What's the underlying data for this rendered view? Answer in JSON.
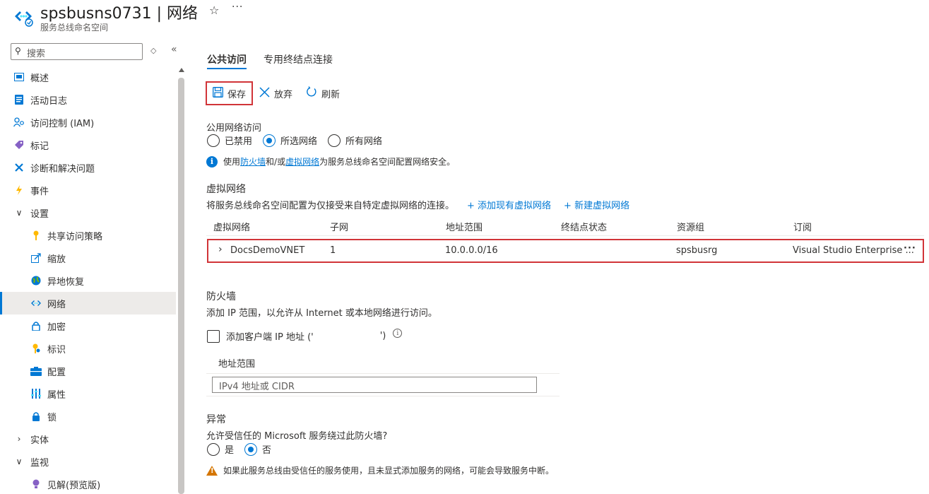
{
  "header": {
    "title": "spsbusns0731 | 网络",
    "subtitle": "服务总线命名空间",
    "star_icon": "☆",
    "more_icon": "···"
  },
  "sidebar": {
    "search_placeholder": "搜索",
    "items": [
      {
        "label": "概述",
        "icon": "overview-icon",
        "level": 0
      },
      {
        "label": "活动日志",
        "icon": "activity-log-icon",
        "level": 0
      },
      {
        "label": "访问控制 (IAM)",
        "icon": "iam-icon",
        "level": 0
      },
      {
        "label": "标记",
        "icon": "tag-icon",
        "level": 0
      },
      {
        "label": "诊断和解决问题",
        "icon": "wrench-icon",
        "level": 0
      },
      {
        "label": "事件",
        "icon": "bolt-icon",
        "level": 0
      },
      {
        "label": "设置",
        "icon": "chevron-down-icon",
        "level": 0,
        "group": true,
        "expanded": true
      },
      {
        "label": "共享访问策略",
        "icon": "key-icon",
        "level": 1
      },
      {
        "label": "缩放",
        "icon": "scale-icon",
        "level": 1
      },
      {
        "label": "异地恢复",
        "icon": "globe-icon",
        "level": 1
      },
      {
        "label": "网络",
        "icon": "network-icon",
        "level": 1,
        "active": true
      },
      {
        "label": "加密",
        "icon": "lock-icon",
        "level": 1
      },
      {
        "label": "标识",
        "icon": "identity-icon",
        "level": 1
      },
      {
        "label": "配置",
        "icon": "config-icon",
        "level": 1
      },
      {
        "label": "属性",
        "icon": "properties-icon",
        "level": 1
      },
      {
        "label": "锁",
        "icon": "lock-icon",
        "level": 1
      },
      {
        "label": "实体",
        "icon": "chevron-right-icon",
        "level": 0,
        "group": true,
        "expanded": false
      },
      {
        "label": "监视",
        "icon": "chevron-down-icon",
        "level": 0,
        "group": true,
        "expanded": true
      },
      {
        "label": "见解(预览版)",
        "icon": "insights-icon",
        "level": 1
      }
    ]
  },
  "tabs": {
    "public": "公共访问",
    "private": "专用终结点连接"
  },
  "toolbar": {
    "save": "保存",
    "discard": "放弃",
    "refresh": "刷新"
  },
  "public_access": {
    "label": "公用网络访问",
    "options": [
      "已禁用",
      "所选网络",
      "所有网络"
    ],
    "selected": "所选网络",
    "info_prefix": "使用",
    "info_firewall": "防火墙",
    "info_mid": "和/或",
    "info_vnet": "虚拟网络",
    "info_suffix": "为服务总线命名空间配置网络安全。"
  },
  "vnet": {
    "heading": "虚拟网络",
    "description": "将服务总线命名空间配置为仅接受来自特定虚拟网络的连接。",
    "add_existing": "+ 添加现有虚拟网络",
    "create_new": "+ 新建虚拟网络",
    "columns": [
      "虚拟网络",
      "子网",
      "地址范围",
      "终结点状态",
      "资源组",
      "订阅"
    ],
    "rows": [
      {
        "name": "DocsDemoVNET",
        "subnet": "1",
        "address": "10.0.0.0/16",
        "status": "",
        "rg": "spsbusrg",
        "subscription": "Visual Studio Enterprise ..."
      }
    ]
  },
  "firewall": {
    "heading": "防火墙",
    "description": "添加 IP 范围，以允许从 Internet 或本地网络进行访问。",
    "client_ip_label": "添加客户端 IP 地址 ('",
    "client_ip_close": "')",
    "address_header": "地址范围",
    "address_placeholder": "IPv4 地址或 CIDR"
  },
  "exceptions": {
    "heading": "异常",
    "question": "允许受信任的 Microsoft 服务绕过此防火墙?",
    "options": [
      "是",
      "否"
    ],
    "selected": "否",
    "warning": "如果此服务总线由受信任的服务使用，且未显式添加服务的网络，可能会导致服务中断。"
  },
  "colors": {
    "accent": "#0078d4",
    "highlight_border": "#d13438",
    "warning": "#d47500"
  }
}
